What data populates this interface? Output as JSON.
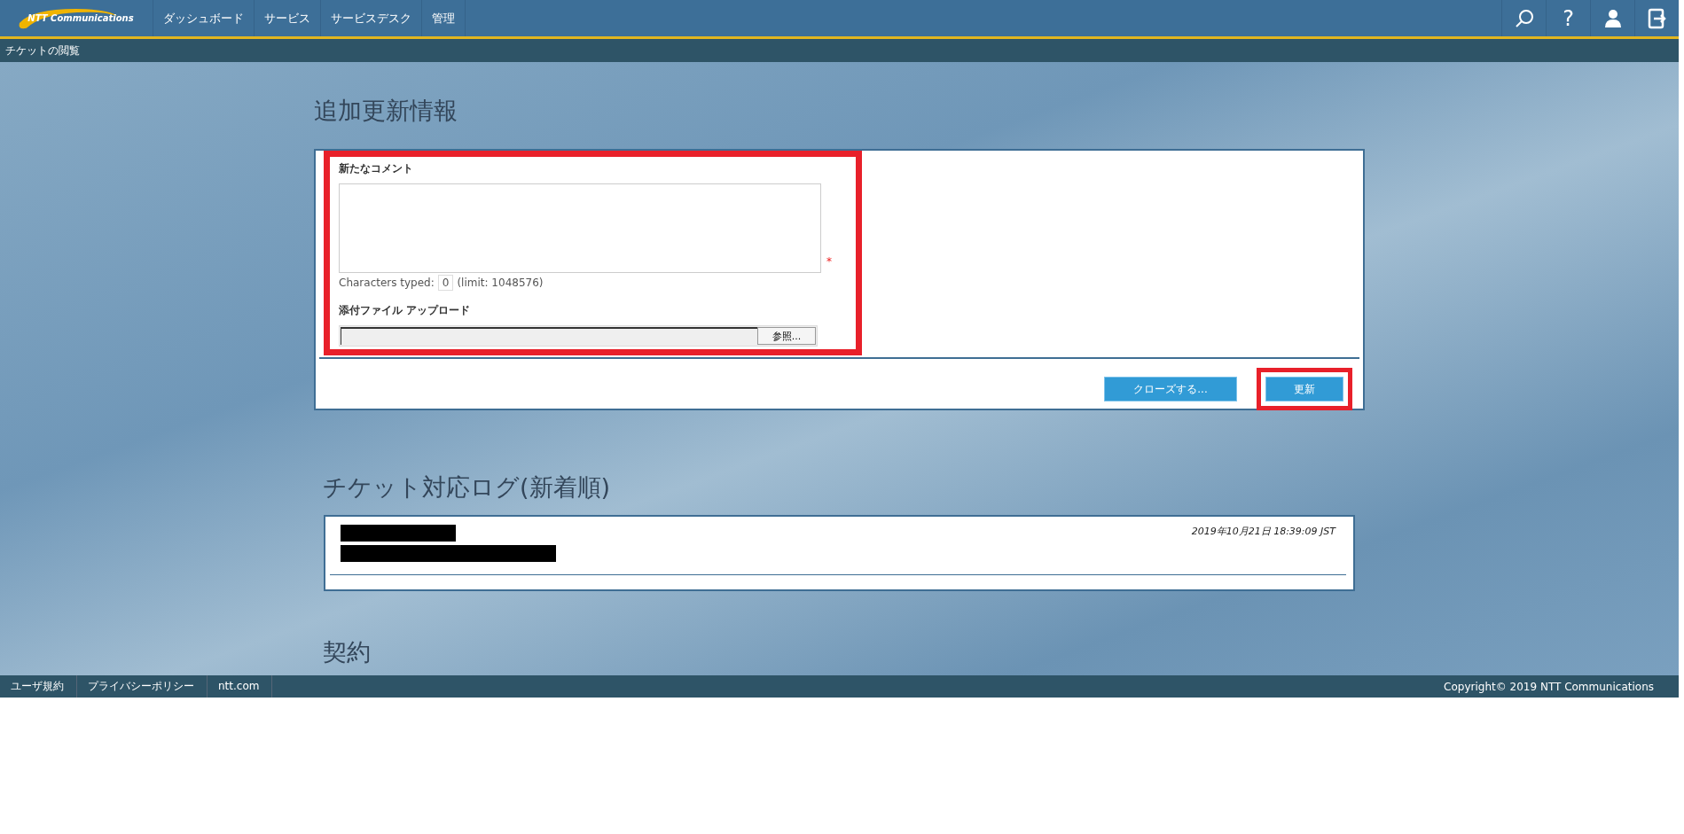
{
  "header": {
    "logo_text": "NTT Communications",
    "nav": [
      {
        "label": "ダッシュボード",
        "selected": false
      },
      {
        "label": "サービス",
        "selected": false
      },
      {
        "label": "サービスデスク",
        "selected": false
      },
      {
        "label": "管理",
        "selected": false
      }
    ],
    "tools": [
      {
        "kind": "search"
      },
      {
        "kind": "help",
        "label": "?"
      },
      {
        "kind": "user"
      },
      {
        "kind": "logout"
      }
    ]
  },
  "breadcrumb": "チケットの閲覧",
  "update_section": {
    "title": "追加更新情報",
    "comment_label": "新たなコメント",
    "required_mark": "*",
    "counter_label": "Characters typed:",
    "counter_value": "0",
    "counter_limit": "(limit: 1048576)",
    "upload_label": "添付ファイル アップロード",
    "browse_button": "参照...",
    "buttons": [
      {
        "label": "クローズする...",
        "highlighted": false
      },
      {
        "label": "更新",
        "highlighted": true
      }
    ],
    "form_highlighted": true
  },
  "log_section": {
    "title": "チケット対応ログ(新着順)",
    "entries": [
      {
        "timestamp": "2019年10月21日 18:39:09 JST",
        "lines": [
          {
            "kind": "redacted"
          },
          {
            "kind": "redacted"
          }
        ]
      }
    ]
  },
  "contract_section": {
    "title": "契約"
  },
  "footer": {
    "links": [
      "ユーザ規約",
      "プライバシーポリシー",
      "ntt.com"
    ],
    "copyright": "Copyright© 2019 NTT Communications"
  }
}
